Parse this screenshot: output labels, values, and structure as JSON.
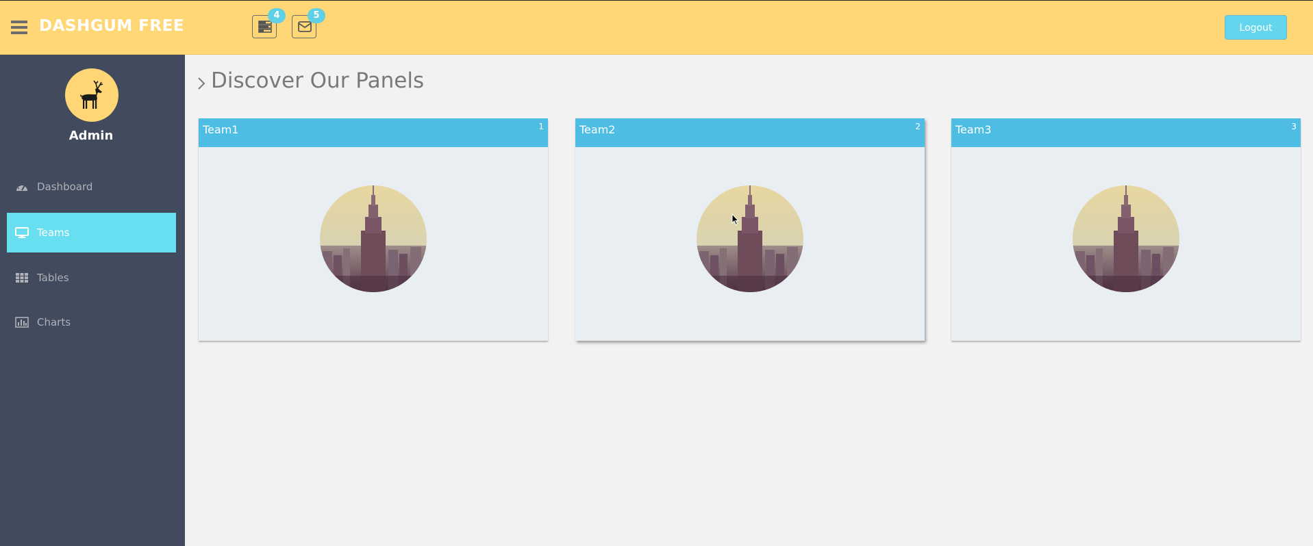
{
  "header": {
    "brand": "DASHGUM FREE",
    "tasks_badge": "4",
    "messages_badge": "5",
    "logout_label": "Logout"
  },
  "sidebar": {
    "user_name": "Admin",
    "items": [
      {
        "label": "Dashboard",
        "icon": "dashboard-icon",
        "active": false
      },
      {
        "label": "Teams",
        "icon": "desktop-icon",
        "active": true
      },
      {
        "label": "Tables",
        "icon": "grid-icon",
        "active": false
      },
      {
        "label": "Charts",
        "icon": "bar-chart-icon",
        "active": false
      }
    ]
  },
  "main": {
    "title": "Discover Our Panels",
    "panels": [
      {
        "title": "Team1",
        "number": "1"
      },
      {
        "title": "Team2",
        "number": "2"
      },
      {
        "title": "Team3",
        "number": "3"
      }
    ]
  },
  "colors": {
    "header_bg": "#ffd777",
    "sidebar_bg": "#424a5d",
    "accent": "#68dff0",
    "panel_header": "#4ebde4"
  }
}
